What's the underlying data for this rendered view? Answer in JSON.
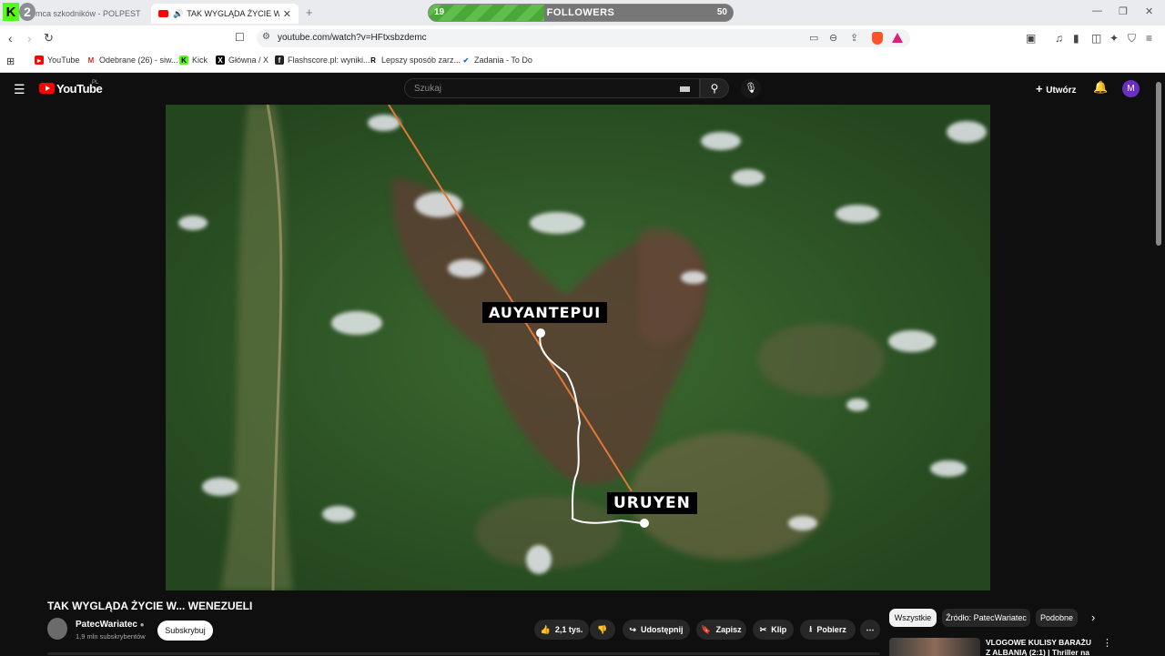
{
  "browser": {
    "tabs": [
      {
        "label": "omca szkodników - POLPEST - Y"
      },
      {
        "label": "TAK WYGLĄDA ŻYCIE W... WE"
      }
    ],
    "kick_badge": "2",
    "followers": {
      "current": "19",
      "label": "FOLLOWERS",
      "goal": "50",
      "fraction": 0.38
    },
    "url": "youtube.com/watch?v=HFtxsbzdemc",
    "bookmarks": [
      {
        "label": "YouTube",
        "icon": "youtube-icon"
      },
      {
        "label": "Odebrane (26) - siw...",
        "icon": "gmail-icon"
      },
      {
        "label": "Kick",
        "icon": "kick-icon"
      },
      {
        "label": "Główna / X",
        "icon": "x-icon"
      },
      {
        "label": "Flashscore.pl: wyniki...",
        "icon": "flashscore-icon"
      },
      {
        "label": "Lepszy sposób zarz...",
        "icon": "r-icon"
      },
      {
        "label": "Zadania - To Do",
        "icon": "todo-icon"
      }
    ]
  },
  "youtube": {
    "logo_text": "YouTube",
    "logo_region": "PL",
    "search_placeholder": "Szukaj",
    "create_label": "Utwórz",
    "avatar_letter": "M",
    "video": {
      "labels": [
        "AUYANTEPUI",
        "URUYEN"
      ]
    },
    "title": "TAK WYGLĄDA ŻYCIE W... WENEZUELI",
    "channel": {
      "name": "PatecWariatec",
      "subs": "1,9 mln subskrybentów",
      "subscribe_label": "Subskrybuj"
    },
    "actions": {
      "likes": "2,1 tys.",
      "share": "Udostępnij",
      "save": "Zapisz",
      "clip": "Klip",
      "download": "Pobierz",
      "more": "⋯"
    },
    "chips": [
      "Wszystkie",
      "Źródło: PatecWariatec",
      "Podobne"
    ],
    "recommendation": {
      "title": "VLOGOWE KULISY BARAŻU Z ALBANIĄ (2:1) | Thriller na"
    }
  }
}
